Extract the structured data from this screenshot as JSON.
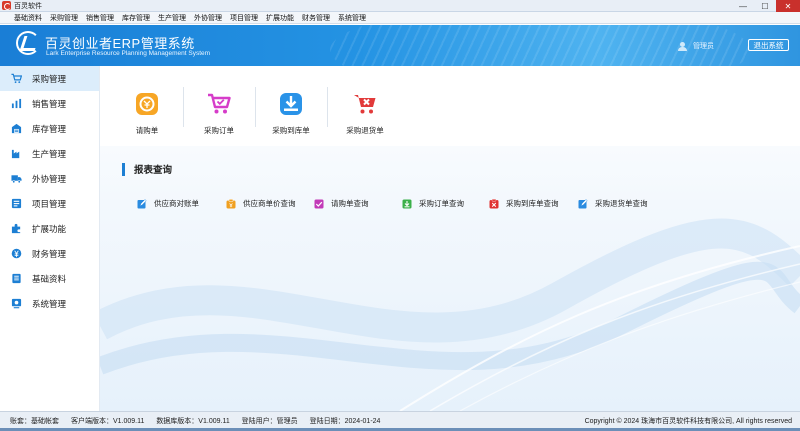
{
  "window": {
    "title": "百灵软件",
    "controls": {
      "minimize": "—",
      "maximize": "☐",
      "close": "✕"
    }
  },
  "menu": [
    "基础资料",
    "采购管理",
    "销售管理",
    "库存管理",
    "生产管理",
    "外协管理",
    "项目管理",
    "扩展功能",
    "财务管理",
    "系统管理"
  ],
  "header": {
    "title": "百灵创业者ERP管理系统",
    "subtitle": "Lark Enterprise Resource Planning Management System",
    "user": "管理员",
    "logout": "退出系统"
  },
  "sidebar": {
    "items": [
      {
        "label": "采购管理",
        "icon": "cart-icon",
        "active": true
      },
      {
        "label": "销售管理",
        "icon": "chart-icon",
        "active": false
      },
      {
        "label": "库存管理",
        "icon": "warehouse-icon",
        "active": false
      },
      {
        "label": "生产管理",
        "icon": "factory-icon",
        "active": false
      },
      {
        "label": "外协管理",
        "icon": "truck-icon",
        "active": false
      },
      {
        "label": "项目管理",
        "icon": "list-icon",
        "active": false
      },
      {
        "label": "扩展功能",
        "icon": "puzzle-icon",
        "active": false
      },
      {
        "label": "财务管理",
        "icon": "money-icon",
        "active": false
      },
      {
        "label": "基础资料",
        "icon": "book-icon",
        "active": false
      },
      {
        "label": "系统管理",
        "icon": "gear-icon",
        "active": false
      }
    ]
  },
  "toolbar": {
    "items": [
      {
        "label": "请购单",
        "icon": "request-icon",
        "color": "#f39a1e"
      },
      {
        "label": "采购订单",
        "icon": "cart-check-icon",
        "color": "#d63cc9"
      },
      {
        "label": "采购到库单",
        "icon": "inbound-icon",
        "color": "#2a93e8"
      },
      {
        "label": "采购退货单",
        "icon": "return-icon",
        "color": "#e23a3a"
      }
    ]
  },
  "reports": {
    "title": "报表查询",
    "items": [
      {
        "label": "供应商对账单",
        "icon": "edit-icon",
        "color": "#2a8be0"
      },
      {
        "label": "供应商单价查询",
        "icon": "price-icon",
        "color": "#f0a020"
      },
      {
        "label": "请购单查询",
        "icon": "check-icon",
        "color": "#c23ab8"
      },
      {
        "label": "采购订单查询",
        "icon": "download-icon",
        "color": "#3bb04a"
      },
      {
        "label": "采购到库单查询",
        "icon": "x-icon",
        "color": "#e03030"
      },
      {
        "label": "采购退货单查询",
        "icon": "edit-icon",
        "color": "#2a8be0"
      }
    ]
  },
  "status": {
    "account": "账套：基础帐套",
    "client_version": "客户端版本：V1.009.11",
    "db_version": "数据库版本：V1.009.11",
    "user": "登陆用户：管理员",
    "date": "登陆日期：2024-01-24",
    "copyright": "Copyright © 2024 珠海市百灵软件科技有限公司, All rights reserved"
  },
  "colors": {
    "accent": "#1d7fd3",
    "header": "#2493e3",
    "active_bg": "#dcedfb"
  }
}
